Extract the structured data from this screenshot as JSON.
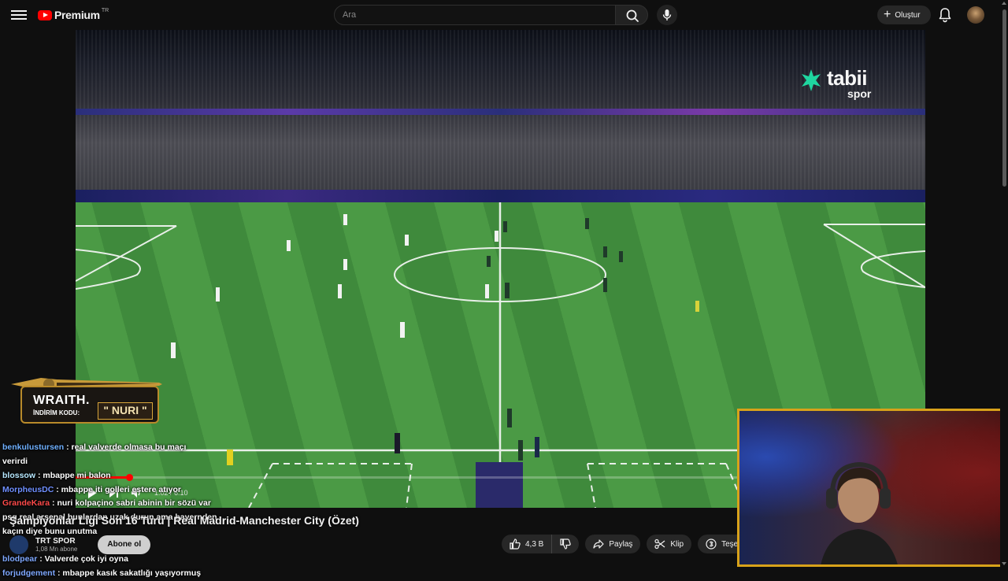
{
  "header": {
    "logo_text": "Premium",
    "logo_region": "TR",
    "search_placeholder": "Ara",
    "create_label": "Oluştur"
  },
  "player": {
    "broadcaster_logo": "tabii",
    "broadcaster_sub": "spor",
    "time_display": "1:02 / 6:10"
  },
  "sponsor": {
    "title": "WRAITH.",
    "code_label": "İNDİRİM KODU:",
    "code": "\" NURI \""
  },
  "chat": [
    {
      "user": "benkulustursen",
      "color": "#6fb0ff",
      "msg": ": real valverde olmasa bu maçı"
    },
    {
      "user": "",
      "color": "#ffffff",
      "msg": "verirdi"
    },
    {
      "user": "blossow",
      "color": "#b7e8ff",
      "msg": ": mbappe mi balon"
    },
    {
      "user": "MorpheusDC",
      "color": "#6f8fff",
      "msg": ": mbappe iti golleri estere atıyor"
    },
    {
      "user": "GrandeKara",
      "color": "#ff4a4a",
      "msg": ": nuri kolpaçino sabri abinin bir sözü var"
    },
    {
      "user": "",
      "color": "#ffffff",
      "msg": "psg real arsenal bunlardan uzak durun ama bayernden"
    },
    {
      "user": "",
      "color": "#ffffff",
      "msg": "kaçın diye bunu unutma"
    },
    {
      "user": "blodpear",
      "color": "#7fa8ff",
      "msg": ": Valverde çok iyi oyna"
    },
    {
      "user": "forjudgement",
      "color": "#7fa8ff",
      "msg": ": mbappe kasık sakatlığı yaşıyormuş"
    }
  ],
  "video": {
    "title": "Şampiyonlar Ligi Son 16 Turu | Real Madrid-Manchester City (Özet)",
    "channel_name": "TRT SPOR",
    "channel_subs": "1,08 Mn abone",
    "subscribe_label": "Abone ol",
    "like_count": "4,3 B",
    "share_label": "Paylaş",
    "clip_label": "Klip",
    "thanks_label": "Teşekkürler"
  },
  "colors": {
    "accent": "#ff0000",
    "webcam_border": "#d8a21a",
    "background": "#0f0f0f"
  }
}
